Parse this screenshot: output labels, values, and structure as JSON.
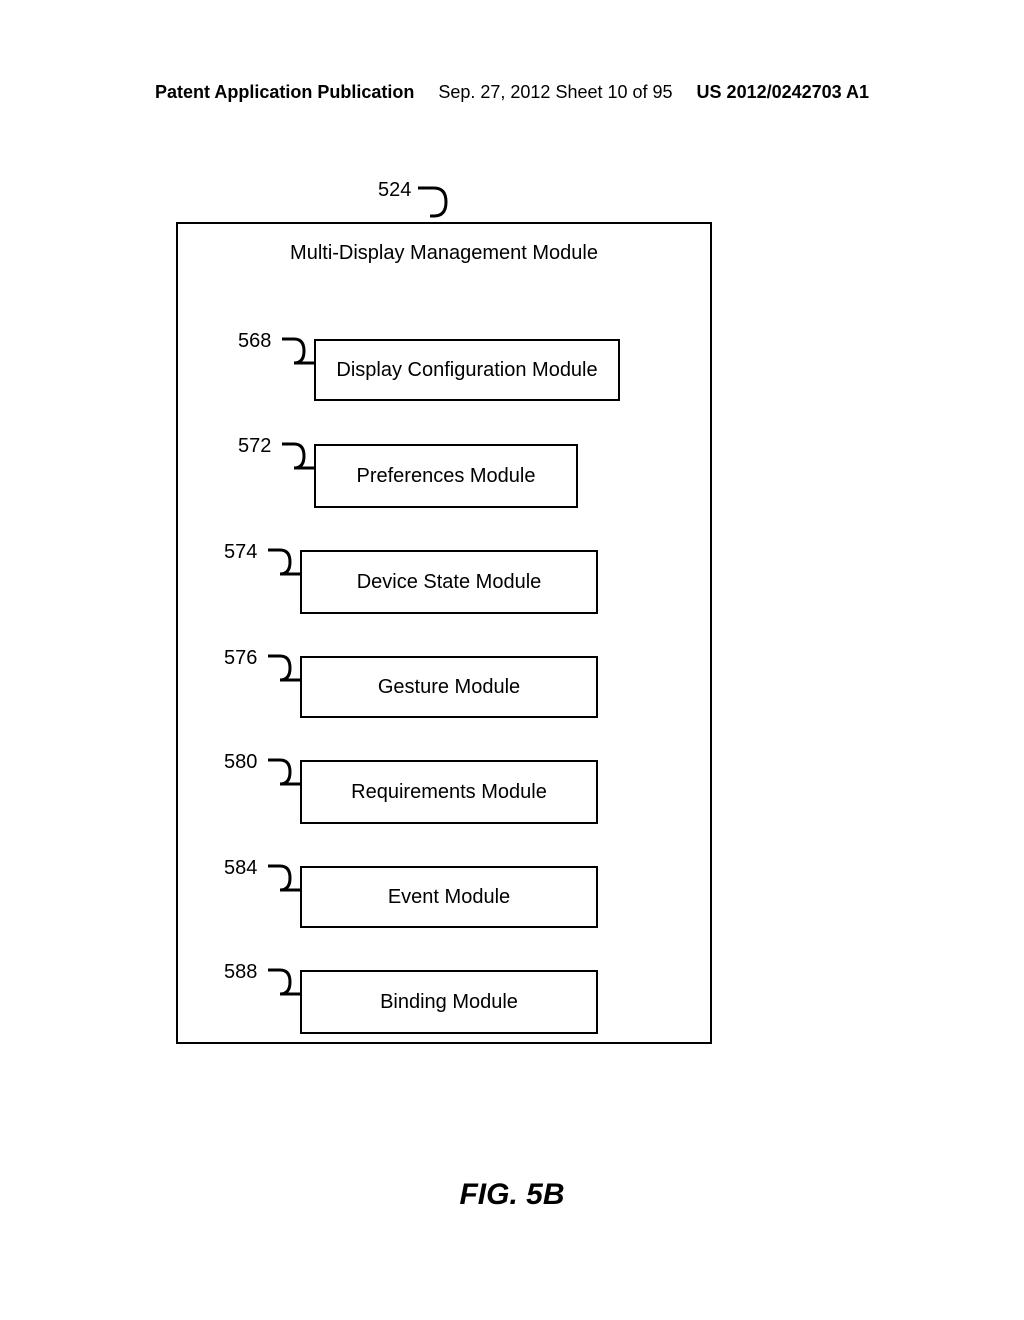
{
  "header": {
    "left": "Patent Application Publication",
    "mid": "Sep. 27, 2012  Sheet 10 of 95",
    "right": "US 2012/0242703 A1"
  },
  "diagram": {
    "outer_ref": "524",
    "title": "Multi-Display Management Module",
    "modules": {
      "m568": {
        "ref": "568",
        "label": "Display Configuration Module"
      },
      "m572": {
        "ref": "572",
        "label": "Preferences Module"
      },
      "m574": {
        "ref": "574",
        "label": "Device State Module"
      },
      "m576": {
        "ref": "576",
        "label": "Gesture Module"
      },
      "m580": {
        "ref": "580",
        "label": "Requirements Module"
      },
      "m584": {
        "ref": "584",
        "label": "Event Module"
      },
      "m588": {
        "ref": "588",
        "label": "Binding Module"
      }
    }
  },
  "figure_caption": "FIG. 5B"
}
